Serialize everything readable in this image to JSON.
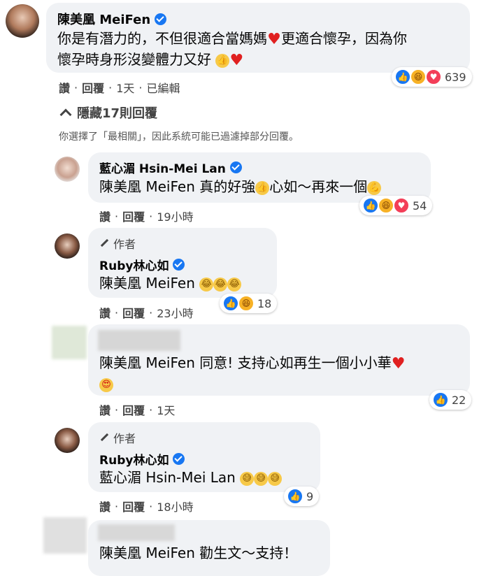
{
  "comment1": {
    "name": "陳美凰 MeiFen",
    "line1": "你是有潛力的，不但很適合當媽媽",
    "line1b": "更適合懷孕，因為你",
    "line2": "懷孕時身形沒變體力又好",
    "actions": {
      "like": "讚",
      "reply": "回覆",
      "time": "1天",
      "edited": "已編輯"
    },
    "reaction_count": "639"
  },
  "hide_replies": "隱藏17則回覆",
  "filter_notice": "你選擇了「最相關」，因此系統可能已過濾掉部分回覆。",
  "reply1": {
    "name": "藍心湄 Hsin-Mei Lan",
    "text": "陳美凰 MeiFen 真的好強",
    "text2": "心如～再來一個",
    "actions": {
      "like": "讚",
      "reply": "回覆",
      "time": "19小時"
    },
    "reaction_count": "54"
  },
  "reply2": {
    "author_label": "作者",
    "name": "Ruby林心如",
    "text": "陳美凰 MeiFen",
    "actions": {
      "like": "讚",
      "reply": "回覆",
      "time": "23小時"
    },
    "reaction_count": "18"
  },
  "reply3": {
    "text": "陳美凰 MeiFen 同意! 支持心如再生一個小小華",
    "actions": {
      "like": "讚",
      "reply": "回覆",
      "time": "1天"
    },
    "reaction_count": "22"
  },
  "reply4": {
    "author_label": "作者",
    "name": "Ruby林心如",
    "text": "藍心湄 Hsin-Mei Lan",
    "actions": {
      "like": "讚",
      "reply": "回覆",
      "time": "18小時"
    },
    "reaction_count": "9"
  },
  "reply5": {
    "text": "陳美凰 MeiFen 勸生文～支持！"
  },
  "colors": {
    "bubble": "#f0f2f5",
    "like_blue": "#1877f2",
    "heart_red": "#f33e58",
    "haha_yellow": "#f7b125"
  }
}
